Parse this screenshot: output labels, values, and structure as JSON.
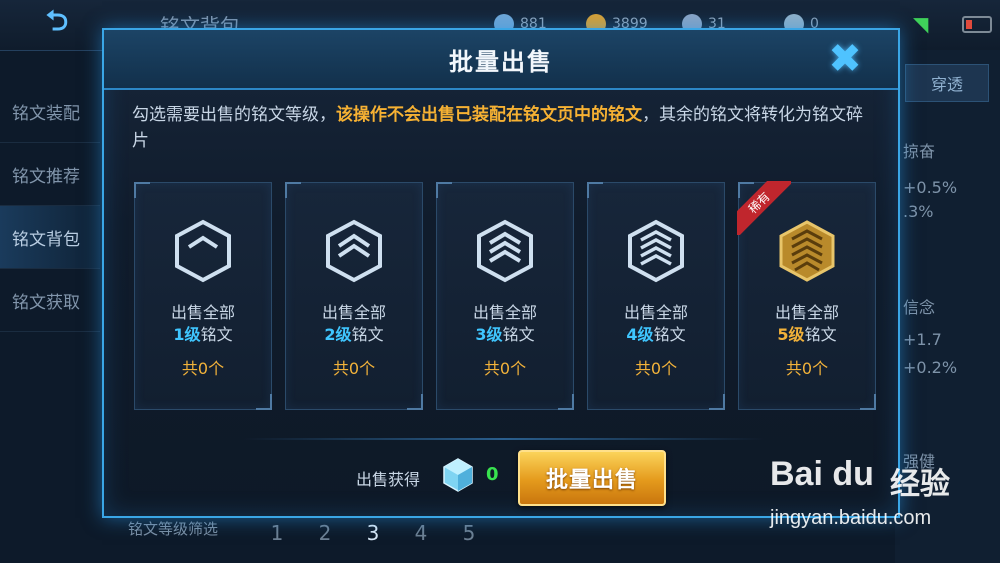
{
  "background": {
    "title": "铭文背包",
    "resources": [
      {
        "icon": "cube-icon",
        "value": "881",
        "color": "#6fa6d6"
      },
      {
        "icon": "coin-icon",
        "value": "3899",
        "color": "#d9a032"
      },
      {
        "icon": "diamond-icon",
        "value": "31",
        "color": "#8aa4c4"
      },
      {
        "icon": "leaf-icon",
        "value": "0",
        "color": "#8fb0c8"
      }
    ],
    "nav": [
      {
        "label": "铭文装配",
        "active": false
      },
      {
        "label": "铭文推荐",
        "active": false
      },
      {
        "label": "铭文背包",
        "active": true
      },
      {
        "label": "铭文获取",
        "active": false
      }
    ],
    "right_tab": "穿透",
    "right_texts": [
      "掠奋",
      "+0.5%",
      ".3%",
      "信念",
      "+1.7",
      "+0.2%",
      "强健"
    ],
    "filter_label": "铭文等级筛选",
    "filter_levels": [
      "1",
      "2",
      "3",
      "4",
      "5"
    ],
    "filter_active": "3"
  },
  "modal": {
    "title": "批量出售",
    "desc_prefix": "勾选需要出售的铭文等级，",
    "desc_warning": "该操作不会出售已装配在铭文页中的铭文",
    "desc_suffix": "，其余的铭文将转化为铭文碎片",
    "cards": [
      {
        "line1": "出售全部",
        "level": "1级",
        "suffix": "铭文",
        "count": "共0个",
        "level_color": "#3fc6ff",
        "rare": false
      },
      {
        "line1": "出售全部",
        "level": "2级",
        "suffix": "铭文",
        "count": "共0个",
        "level_color": "#3fc6ff",
        "rare": false
      },
      {
        "line1": "出售全部",
        "level": "3级",
        "suffix": "铭文",
        "count": "共0个",
        "level_color": "#3fc6ff",
        "rare": false
      },
      {
        "line1": "出售全部",
        "level": "4级",
        "suffix": "铭文",
        "count": "共0个",
        "level_color": "#3fc6ff",
        "rare": false
      },
      {
        "line1": "出售全部",
        "level": "5级",
        "suffix": "铭文",
        "count": "共0个",
        "level_color": "#f2b23a",
        "rare": true,
        "rare_label": "稀有"
      }
    ],
    "gain_label": "出售获得",
    "gain_value": "0",
    "sell_button": "批量出售"
  },
  "watermark": {
    "logo": "Bai du",
    "cn": "经验",
    "url": "jingyan.baidu.com"
  }
}
